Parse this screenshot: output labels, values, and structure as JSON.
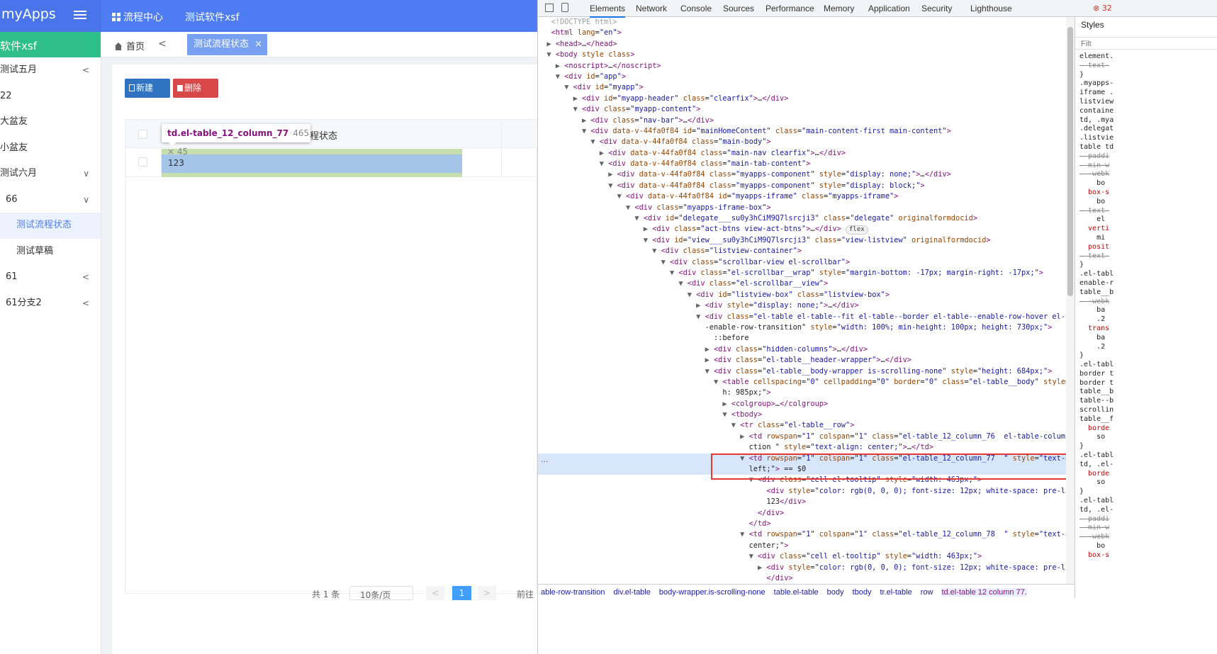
{
  "header": {
    "brand": "myApps",
    "nav": [
      "流程中心",
      "测试软件xsf"
    ],
    "colors": {
      "header": "#4e7cf2",
      "sidebar_head": "#2ebf8a",
      "active": "#78a0f2"
    }
  },
  "sidebar": {
    "title": "软件xsf",
    "items": [
      {
        "label": "测试五月",
        "arrow": "<"
      },
      {
        "label": "22",
        "arrow": ""
      },
      {
        "label": "大盆友",
        "arrow": ""
      },
      {
        "label": "小盆友",
        "arrow": ""
      },
      {
        "label": "测试六月",
        "arrow": "∨"
      },
      {
        "label": "66",
        "arrow": "∨"
      },
      {
        "label": "测试流程状态",
        "arrow": ""
      },
      {
        "label": "测试草稿",
        "arrow": ""
      },
      {
        "label": "61",
        "arrow": "<"
      },
      {
        "label": "61分支2",
        "arrow": "<"
      }
    ]
  },
  "crumb": {
    "home": "首页",
    "back": "<",
    "tab": "测试流程状态",
    "close": "×"
  },
  "toolbar": {
    "new": "新建",
    "delete": "删除"
  },
  "table": {
    "header_title": "程状态",
    "cell_value": "123"
  },
  "tooltip": {
    "selector": "td.el-table_12_column_77",
    "size": "465 × 45"
  },
  "pager": {
    "total": "共 1 条",
    "size": "10条/页",
    "prev": "<",
    "current": "1",
    "next": ">",
    "goto": "前往"
  },
  "devtools": {
    "tabs": [
      "Elements",
      "Network",
      "Console",
      "Sources",
      "Performance",
      "Memory",
      "Application",
      "Security",
      "Lighthouse"
    ],
    "error_count": "32",
    "lines": [
      [
        "",
        "<!DOCTYPE html>"
      ],
      [
        "",
        "<html lang=\"en\">"
      ],
      [
        "▶",
        "<head>…</head>"
      ],
      [
        "▼",
        "<body style class>"
      ],
      [
        "  ▶",
        "<noscript>…</noscript>"
      ],
      [
        "  ▼",
        "<div id=\"app\">"
      ],
      [
        "    ▼",
        "<div id=\"myapp\">"
      ],
      [
        "      ▶",
        "<div id=\"myapp-header\" class=\"clearfix\">…</div>"
      ],
      [
        "      ▼",
        "<div class=\"myapp-content\">"
      ],
      [
        "        ▶",
        "<div class=\"nav-bar\">…</div>"
      ],
      [
        "        ▼",
        "<div data-v-44fa0f84 id=\"mainHomeContent\" class=\"main-content-first main-content\">"
      ],
      [
        "          ▼",
        "<div data-v-44fa0f84 class=\"main-body\">"
      ],
      [
        "            ▶",
        "<div data-v-44fa0f84 class=\"main-nav clearfix\">…</div>"
      ],
      [
        "            ▼",
        "<div data-v-44fa0f84 class=\"main-tab-content\">"
      ],
      [
        "              ▶",
        "<div data-v-44fa0f84 class=\"myapps-component\" style=\"display: none;\">…</div>"
      ],
      [
        "              ▼",
        "<div data-v-44fa0f84 class=\"myapps-component\" style=\"display: block;\">"
      ],
      [
        "                ▼",
        "<div data-v-44fa0f84 id=\"myapps-iframe\" class=\"myapps-iframe\">"
      ],
      [
        "                  ▼",
        "<div class=\"myapps-iframe-box\">"
      ],
      [
        "                    ▼",
        "<div id=\"delegate___su0y3hCiM9Q7lsrcji3\" class=\"delegate\" originalformdocid>"
      ],
      [
        "                      ▶",
        "<div class=\"act-btns view-act-btns\">…</div> flex"
      ],
      [
        "                      ▼",
        "<div id=\"view___su0y3hCiM9Q7lsrcji3\" class=\"view-listview\" originalformdocid>"
      ],
      [
        "                        ▼",
        "<div class=\"listview-container\">"
      ],
      [
        "                          ▼",
        "<div class=\"scrollbar-view el-scrollbar\">"
      ],
      [
        "                            ▼",
        "<div class=\"el-scrollbar__wrap\" style=\"margin-bottom: -17px; margin-right: -17px;\">"
      ],
      [
        "                              ▼",
        "<div class=\"el-scrollbar__view\">"
      ],
      [
        "                                ▼",
        "<div id=\"listview-box\" class=\"listview-box\">"
      ],
      [
        "                                  ▶",
        "<div style=\"display: none;\">…</div>"
      ],
      [
        "                                  ▼",
        "<div class=\"el-table el-table--fit el-table--border el-table--enable-row-hover el-table-"
      ],
      [
        "                                   ",
        "-enable-row-transition\" style=\"width: 100%; min-height: 100px; height: 730px;\">"
      ],
      [
        "                                     ",
        "::before"
      ],
      [
        "                                    ▶",
        "<div class=\"hidden-columns\">…</div>"
      ],
      [
        "                                    ▶",
        "<div class=\"el-table__header-wrapper\">…</div>"
      ],
      [
        "                                    ▼",
        "<div class=\"el-table__body-wrapper is-scrolling-none\" style=\"height: 684px;\">"
      ],
      [
        "                                      ▼",
        "<table cellspacing=\"0\" cellpadding=\"0\" border=\"0\" class=\"el-table__body\" style=\"widt"
      ],
      [
        "                                       ",
        "h: 985px;\">"
      ],
      [
        "                                        ▶",
        "<colgroup>…</colgroup>"
      ],
      [
        "                                        ▼",
        "<tbody>"
      ],
      [
        "                                          ▼",
        "<tr class=\"el-table__row\">"
      ],
      [
        "                                            ▶",
        "<td rowspan=\"1\" colspan=\"1\" class=\"el-table_12_column_76  el-table-column--sele"
      ],
      [
        "                                             ",
        "ction \" style=\"text-align: center;\">…</td>"
      ],
      [
        "                                            ▼",
        "<td rowspan=\"1\" colspan=\"1\" class=\"el-table_12_column_77  \" style=\"text-align:"
      ],
      [
        "                                             ",
        "left;\"> == $0"
      ],
      [
        "                                              ▼",
        "<div class=\"cell el-tooltip\" style=\"width: 463px;\">"
      ],
      [
        "                                                 ",
        "<div style=\"color: rgb(0, 0, 0); font-size: 12px; white-space: pre-line;\">"
      ],
      [
        "                                                 ",
        "123</div>"
      ],
      [
        "                                               ",
        "</div>"
      ],
      [
        "                                             ",
        "</td>"
      ],
      [
        "                                            ▼",
        "<td rowspan=\"1\" colspan=\"1\" class=\"el-table_12_column_78  \" style=\"text-align:"
      ],
      [
        "                                             ",
        "center;\">"
      ],
      [
        "                                              ▼",
        "<div class=\"cell el-tooltip\" style=\"width: 463px;\">"
      ],
      [
        "                                                ▶",
        "<div style=\"color: rgb(0, 0, 0); font-size: 12px; white-space: pre-line;\">…"
      ],
      [
        "                                                 ",
        "</div>"
      ]
    ],
    "breadcrumbs": [
      "able-row-transition",
      "div.el-table",
      "body-wrapper.is-scrolling-none",
      "table.el-table",
      "body",
      "tbody",
      "tr.el-table",
      "row",
      "td.el-table 12 column 77."
    ],
    "styles_tab": "Styles",
    "styles_filter": "Filt",
    "styles_lines": [
      "element.",
      "  text-",
      "}",
      ".myapps-",
      "iframe .",
      "listview",
      "containe",
      "td, .mya",
      ".delegat",
      ".listvie",
      "table td",
      "  paddi",
      "  min-w",
      "  -webk",
      "    bo",
      "  box-s",
      "    bo",
      "  text-",
      "    el",
      "  verti",
      "    mi",
      "  posit",
      "  text-",
      "}",
      ".el-tabl",
      "enable-r",
      "table__b",
      "  -webk",
      "    ba",
      "    .2",
      "  trans",
      "    ba",
      "    .2",
      "}",
      ".el-tabl",
      "border t",
      "border t",
      "table__b",
      "table--b",
      "scrollin",
      "table__f",
      "  borde",
      "    so",
      "}",
      ".el-tabl",
      "td, .el-",
      "  borde",
      "    so",
      "}",
      ".el-tabl",
      "td, .el-",
      "  paddi",
      "  min-w",
      "  -webk",
      "    bo",
      "  box-s"
    ]
  }
}
